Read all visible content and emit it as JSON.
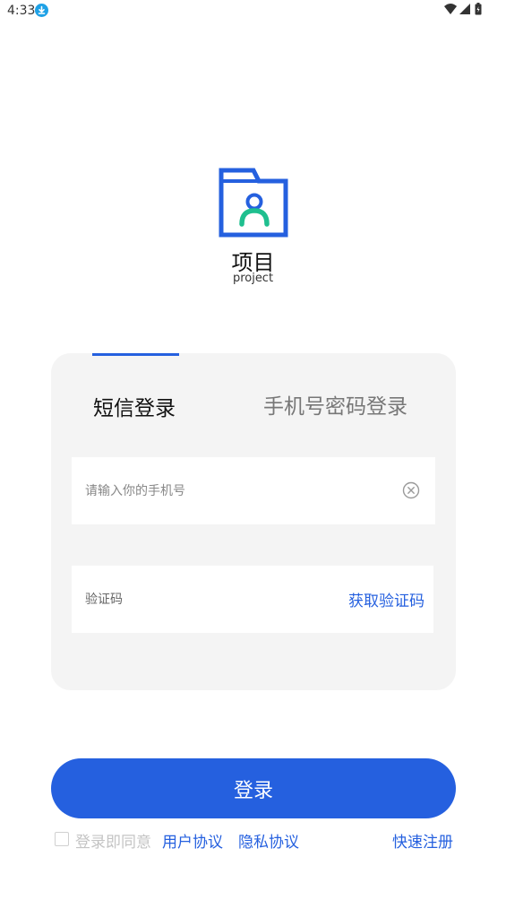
{
  "status_bar": {
    "time": "4:33",
    "icons": [
      "download-icon",
      "wifi-icon",
      "signal-icon",
      "battery-icon"
    ]
  },
  "app": {
    "logo": "folder-user-icon",
    "title": "项目",
    "subtitle": "project"
  },
  "tabs": [
    {
      "label": "短信登录",
      "active": true
    },
    {
      "label": "手机号密码登录",
      "active": false
    }
  ],
  "form": {
    "phone_placeholder": "请输入你的手机号",
    "phone_value": "",
    "code_placeholder": "验证码",
    "code_value": "",
    "get_code_label": "获取验证码"
  },
  "login_button": "登录",
  "agreement": {
    "checked": false,
    "prefix": "登录即同意",
    "user_agreement": "用户协议",
    "privacy_agreement": "隐私协议",
    "quick_register": "快速注册"
  },
  "colors": {
    "accent": "#2560df",
    "logo_green": "#1fbf8f",
    "card_bg": "#f4f4f4",
    "download_badge": "#1ea1e6"
  }
}
